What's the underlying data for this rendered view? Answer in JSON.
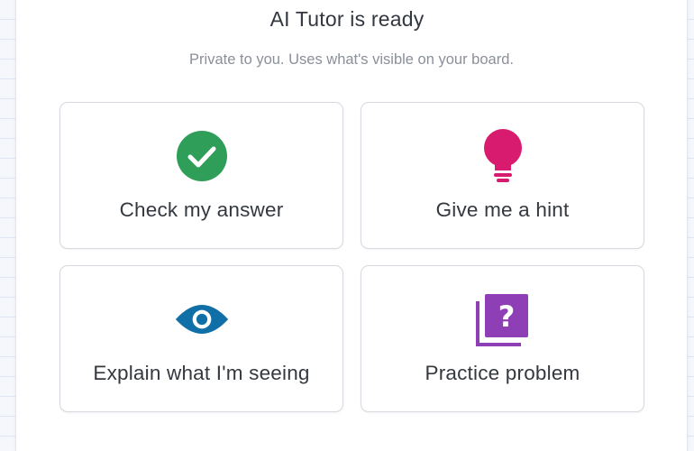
{
  "dialog": {
    "title": "AI Tutor is ready",
    "subtitle": "Private to you. Uses what's visible on your board."
  },
  "options": [
    {
      "label": "Check my answer",
      "icon": "check-circle-icon",
      "color": "#2e9e58"
    },
    {
      "label": "Give me a hint",
      "icon": "lightbulb-icon",
      "color": "#d81b6f"
    },
    {
      "label": "Explain what I'm seeing",
      "icon": "eye-icon",
      "color": "#0f6fa6"
    },
    {
      "label": "Practice problem",
      "icon": "question-cards-icon",
      "color": "#8e3fb5"
    }
  ]
}
